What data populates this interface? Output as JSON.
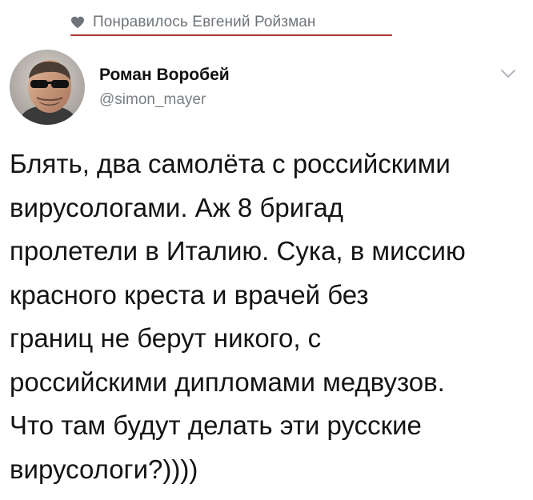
{
  "liked_by": {
    "text": "Понравилось Евгений Ройзман",
    "icon": "heart-icon"
  },
  "author": {
    "name": "Роман Воробей",
    "handle": "@simon_mayer",
    "avatar_icon": "avatar-photo"
  },
  "menu": {
    "icon": "chevron-down-icon"
  },
  "tweet": {
    "lines": [
      "Блять, два самолёта с российскими",
      "вирусологами. Аж 8 бригад",
      "пролетели в Италию. Сука, в миссию",
      "красного креста и врачей без",
      "границ не берут никого, с",
      "российскими дипломами медвузов.",
      "Что там будут делать эти русские",
      "вирусологи?))))"
    ]
  },
  "colors": {
    "underline": "#b03a33",
    "muted_text": "#6e7378",
    "body_text": "#141414"
  }
}
